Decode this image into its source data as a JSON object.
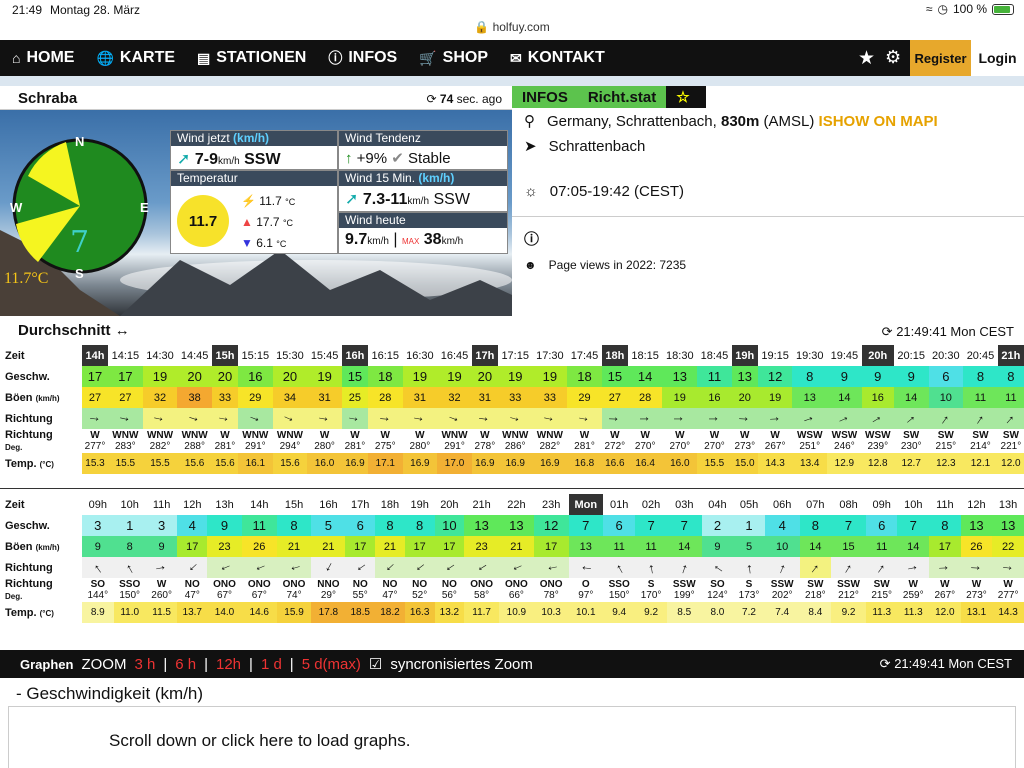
{
  "status": {
    "time": "21:49",
    "date": "Montag 28. März",
    "battery": "100 %",
    "battery_pct": 0.9
  },
  "url": "holfuy.com",
  "nav": {
    "items": [
      {
        "icon": "house-icon",
        "label": "HOME"
      },
      {
        "icon": "globe-icon",
        "label": "KARTE"
      },
      {
        "icon": "chart-icon",
        "label": "STATIONEN"
      },
      {
        "icon": "info-icon",
        "label": "INFOS"
      },
      {
        "icon": "cart-icon",
        "label": "SHOP"
      },
      {
        "icon": "envelope-icon",
        "label": "KONTAKT"
      }
    ],
    "register": "Register",
    "login": "Login"
  },
  "station": {
    "name": "Schraba",
    "ago_num": "74",
    "ago_text": "sec. ago"
  },
  "compass": {
    "n": "N",
    "e": "E",
    "s": "S",
    "w": "W",
    "speed": "7",
    "temp": "11.7°C"
  },
  "wind_now": {
    "title": "Wind jetzt",
    "unit": "(km/h)",
    "value": "7-9",
    "sub": "km/h",
    "dir": "SSW"
  },
  "trend": {
    "title": "Wind Tendenz",
    "value": "+9%",
    "status": "Stable"
  },
  "temp": {
    "title": "Temperatur",
    "big": "11.7",
    "cur": "11.7",
    "max": "17.7",
    "min": "6.1",
    "unit": "°C"
  },
  "wind15": {
    "title": "Wind 15 Min.",
    "unit": "(km/h)",
    "value": "7.3-11",
    "sub": "km/h",
    "dir": "SSW"
  },
  "today": {
    "title": "Wind heute",
    "avg": "9.7",
    "max": "38",
    "unit": "km/h",
    "maxlbl": "MAX"
  },
  "info": {
    "tab1": "INFOS",
    "tab2": "Richt.stat",
    "location": "Germany, Schrattenbach, ",
    "alt": "830m",
    "amsl": " (AMSL) ",
    "map": "ISHOW ON MAPI",
    "place": "Schrattenbach",
    "sun": "07:05-19:42 (CEST)",
    "views": "Page views in 2022: 7235"
  },
  "avg": {
    "title": "Durchschnitt",
    "updated": "21:49:41 Mon CEST"
  },
  "rowlabels": {
    "zeit": "Zeit",
    "speed": "Geschw.",
    "gust": "Böen",
    "gust_unit": "(km/h)",
    "dir": "Richtung",
    "dir2": "Richtung",
    "deg": "Deg.",
    "temp": "Temp.",
    "temp_unit": "(°C)"
  },
  "table1": {
    "times": [
      "14h",
      "14:15",
      "14:30",
      "14:45",
      "15h",
      "15:15",
      "15:30",
      "15:45",
      "16h",
      "16:15",
      "16:30",
      "16:45",
      "17h",
      "17:15",
      "17:30",
      "17:45",
      "18h",
      "18:15",
      "18:30",
      "18:45",
      "19h",
      "19:15",
      "19:30",
      "19:45",
      "20h",
      "20:15",
      "20:30",
      "20:45",
      "21h"
    ],
    "speed": [
      "17",
      "17",
      "19",
      "20",
      "20",
      "16",
      "20",
      "19",
      "15",
      "18",
      "19",
      "19",
      "20",
      "19",
      "19",
      "18",
      "15",
      "14",
      "13",
      "11",
      "13",
      "12",
      "8",
      "9",
      "9",
      "9",
      "6",
      "8",
      "8"
    ],
    "gust": [
      "27",
      "27",
      "32",
      "38",
      "33",
      "29",
      "34",
      "31",
      "25",
      "28",
      "31",
      "32",
      "31",
      "33",
      "33",
      "29",
      "27",
      "28",
      "19",
      "16",
      "20",
      "19",
      "13",
      "14",
      "16",
      "14",
      "10",
      "11",
      "11"
    ],
    "dirs": [
      "W",
      "WNW",
      "WNW",
      "WNW",
      "W",
      "WNW",
      "WNW",
      "W",
      "W",
      "W",
      "W",
      "WNW",
      "W",
      "WNW",
      "WNW",
      "W",
      "W",
      "W",
      "W",
      "W",
      "W",
      "W",
      "WSW",
      "WSW",
      "WSW",
      "SW",
      "SW",
      "SW",
      "SW"
    ],
    "deg": [
      "277°",
      "283°",
      "282°",
      "288°",
      "281°",
      "291°",
      "294°",
      "280°",
      "281°",
      "275°",
      "280°",
      "291°",
      "278°",
      "286°",
      "282°",
      "281°",
      "272°",
      "270°",
      "270°",
      "270°",
      "273°",
      "267°",
      "251°",
      "246°",
      "239°",
      "230°",
      "215°",
      "214°",
      "221°"
    ],
    "temp": [
      "15.3",
      "15.5",
      "15.5",
      "15.6",
      "15.6",
      "16.1",
      "15.6",
      "16.0",
      "16.9",
      "17.1",
      "16.9",
      "17.0",
      "16.9",
      "16.9",
      "16.9",
      "16.8",
      "16.6",
      "16.4",
      "16.0",
      "15.5",
      "15.0",
      "14.3",
      "13.4",
      "12.9",
      "12.8",
      "12.7",
      "12.3",
      "12.1",
      "12.0"
    ],
    "deg_values": [
      277,
      283,
      282,
      288,
      281,
      291,
      294,
      280,
      281,
      275,
      280,
      291,
      278,
      286,
      282,
      281,
      272,
      270,
      270,
      270,
      273,
      267,
      251,
      246,
      239,
      230,
      215,
      214,
      221
    ]
  },
  "table2": {
    "times": [
      "09h",
      "10h",
      "11h",
      "12h",
      "13h",
      "14h",
      "15h",
      "16h",
      "17h",
      "18h",
      "19h",
      "20h",
      "21h",
      "22h",
      "23h",
      "Mon",
      "01h",
      "02h",
      "03h",
      "04h",
      "05h",
      "06h",
      "07h",
      "08h",
      "09h",
      "10h",
      "11h",
      "12h",
      "13h"
    ],
    "speed": [
      "3",
      "1",
      "3",
      "4",
      "9",
      "11",
      "8",
      "5",
      "6",
      "8",
      "8",
      "10",
      "13",
      "13",
      "12",
      "7",
      "6",
      "7",
      "7",
      "2",
      "1",
      "4",
      "8",
      "7",
      "6",
      "7",
      "8",
      "13",
      "13"
    ],
    "gust": [
      "9",
      "8",
      "9",
      "17",
      "23",
      "26",
      "21",
      "21",
      "17",
      "21",
      "17",
      "17",
      "23",
      "21",
      "17",
      "13",
      "11",
      "11",
      "14",
      "9",
      "5",
      "10",
      "14",
      "15",
      "11",
      "14",
      "17",
      "26",
      "22"
    ],
    "dirs": [
      "SO",
      "SSO",
      "W",
      "NO",
      "ONO",
      "ONO",
      "ONO",
      "NNO",
      "NO",
      "NO",
      "NO",
      "NO",
      "ONO",
      "ONO",
      "ONO",
      "O",
      "SSO",
      "S",
      "SSW",
      "SO",
      "S",
      "SSW",
      "SW",
      "SSW",
      "SW",
      "W",
      "W",
      "W",
      "W"
    ],
    "deg": [
      "144°",
      "150°",
      "260°",
      "47°",
      "67°",
      "67°",
      "74°",
      "29°",
      "55°",
      "47°",
      "52°",
      "56°",
      "58°",
      "66°",
      "78°",
      "97°",
      "150°",
      "170°",
      "199°",
      "124°",
      "173°",
      "202°",
      "218°",
      "212°",
      "215°",
      "259°",
      "267°",
      "273°",
      "277°"
    ],
    "temp": [
      "8.9",
      "11.0",
      "11.5",
      "13.7",
      "14.0",
      "14.6",
      "15.9",
      "17.8",
      "18.5",
      "18.2",
      "16.3",
      "13.2",
      "11.7",
      "10.9",
      "10.3",
      "10.1",
      "9.4",
      "9.2",
      "8.5",
      "8.0",
      "7.2",
      "7.4",
      "8.4",
      "9.2",
      "11.3",
      "11.3",
      "12.0",
      "13.1",
      "14.3"
    ],
    "deg_values": [
      144,
      150,
      260,
      47,
      67,
      67,
      74,
      29,
      55,
      47,
      52,
      56,
      58,
      66,
      78,
      97,
      150,
      170,
      199,
      124,
      173,
      202,
      218,
      212,
      215,
      259,
      267,
      273,
      277
    ]
  },
  "graphs": {
    "title": "Graphen",
    "zoom": "ZOOM",
    "z3": "3 h",
    "z6": "6 h",
    "z12": "12h",
    "z1": "1 d",
    "z5": "5 d(max)",
    "sync": "syncronisiertes Zoom",
    "updated": "21:49:41 Mon CEST",
    "speed_title": "- Geschwindigkeit (km/h)",
    "load": "Scroll down or click here to load graphs."
  }
}
